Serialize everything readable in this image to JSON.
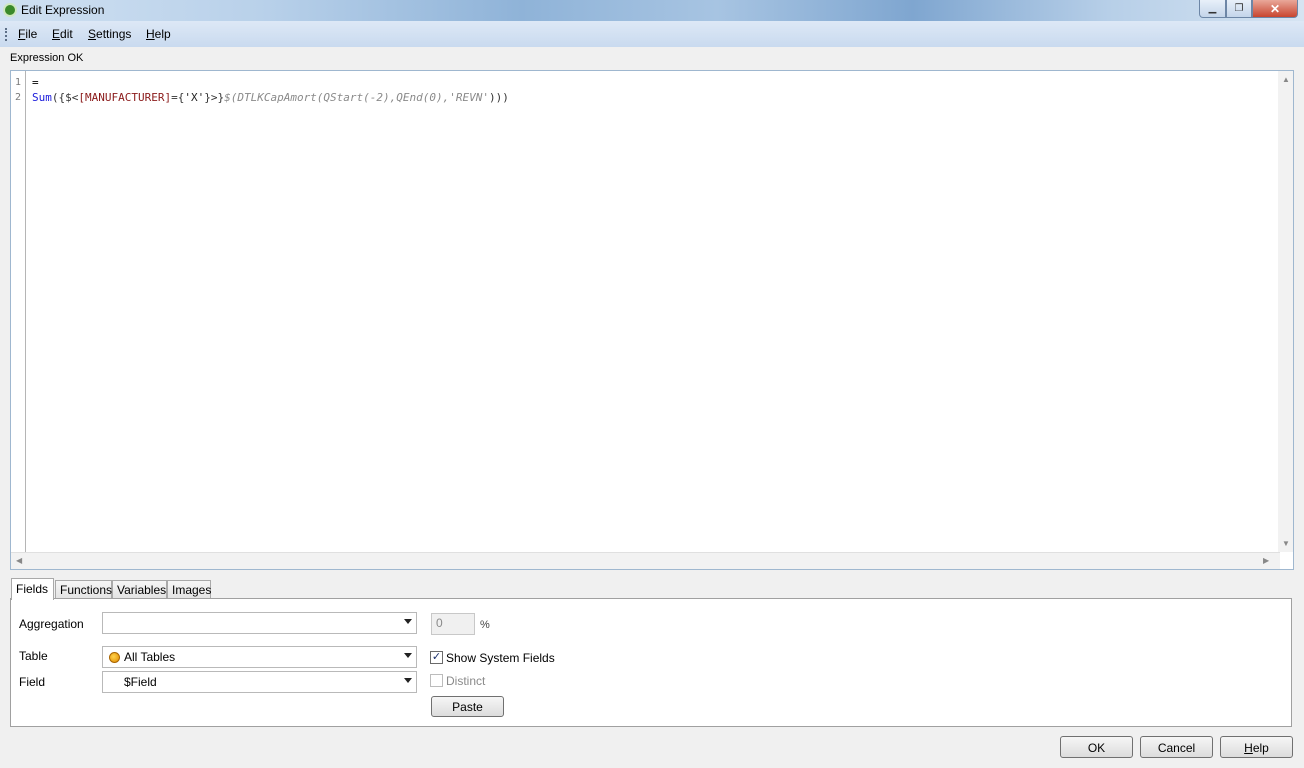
{
  "window": {
    "title": "Edit Expression",
    "min_icon": "minimize-icon",
    "max_icon": "restore-icon",
    "close_icon": "close-icon",
    "min_glyph": "▁",
    "max_glyph": "❐",
    "close_glyph": "✕"
  },
  "menu": {
    "file_first": "F",
    "file_rest": "ile",
    "edit_first": "E",
    "edit_rest": "dit",
    "settings_first": "S",
    "settings_rest": "ettings",
    "help_first": "H",
    "help_rest": "elp"
  },
  "status": "Expression OK",
  "editor": {
    "line_numbers": [
      "1",
      "2"
    ],
    "line1": "=",
    "line2_tokens": {
      "fn": "Sum",
      "open": "({$<",
      "field": "[MANUFACTURER]",
      "eq": "={",
      "str": "'X'",
      "close": "}>}",
      "var": "$(DTLKCapAmort(QStart(-2),QEnd(0),'REVN'",
      "end": ")))"
    },
    "scroll_up": "▲",
    "scroll_down": "▼",
    "scroll_left": "◀",
    "scroll_right": "▶"
  },
  "tabs": [
    "Fields",
    "Functions",
    "Variables",
    "Images"
  ],
  "fields_panel": {
    "aggregation_label": "Aggregation",
    "aggregation_value": "",
    "percent_value": "0",
    "percent_symbol": "%",
    "table_label": "Table",
    "table_value": "All Tables",
    "field_label": "Field",
    "field_value": "$Field",
    "show_system_fields_label": "Show System Fields",
    "show_system_fields_checked": "✓",
    "distinct_label": "Distinct",
    "paste_label": "Paste"
  },
  "buttons": {
    "ok": "OK",
    "cancel": "Cancel",
    "help_first": "H",
    "help_rest": "elp"
  }
}
